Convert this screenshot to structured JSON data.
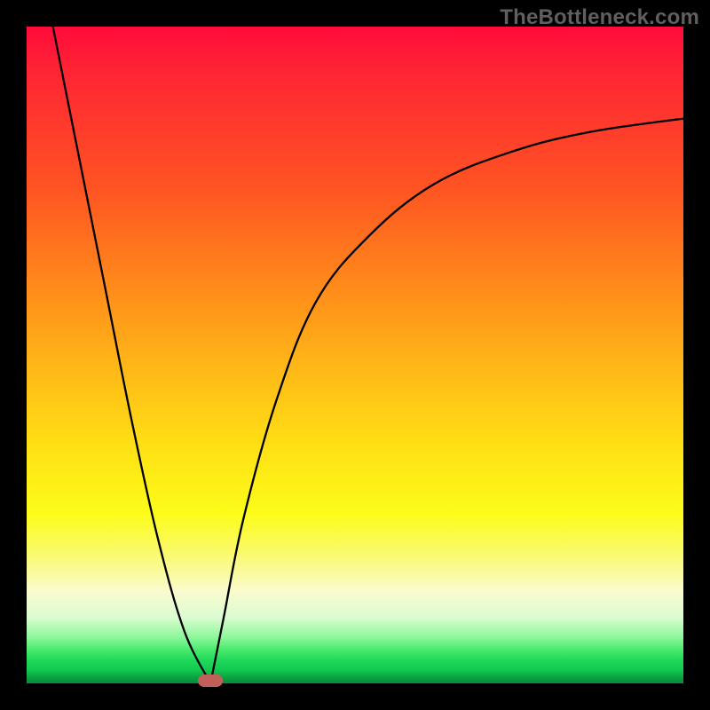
{
  "watermark": "TheBottleneck.com",
  "chart_data": {
    "type": "line",
    "title": "",
    "xlabel": "",
    "ylabel": "",
    "x_range": [
      0,
      100
    ],
    "y_range": [
      0,
      100
    ],
    "minimum_x": 28,
    "minimum_y": 0,
    "curve_color": "#000000",
    "curve_width": 2.3,
    "series": [
      {
        "name": "left-branch",
        "x": [
          4,
          8,
          12,
          16,
          20,
          24,
          28
        ],
        "values": [
          100,
          80,
          60,
          40,
          22,
          8,
          0
        ]
      },
      {
        "name": "right-branch",
        "x": [
          28,
          30,
          33,
          38,
          44,
          52,
          62,
          74,
          86,
          100
        ],
        "values": [
          0,
          10,
          25,
          43,
          58,
          68,
          76,
          81,
          84,
          86
        ]
      }
    ],
    "minimum_marker": {
      "x": 28,
      "y": 0,
      "color": "#c06058"
    },
    "background_gradient_desc": "vertical red→orange→yellow→green"
  }
}
